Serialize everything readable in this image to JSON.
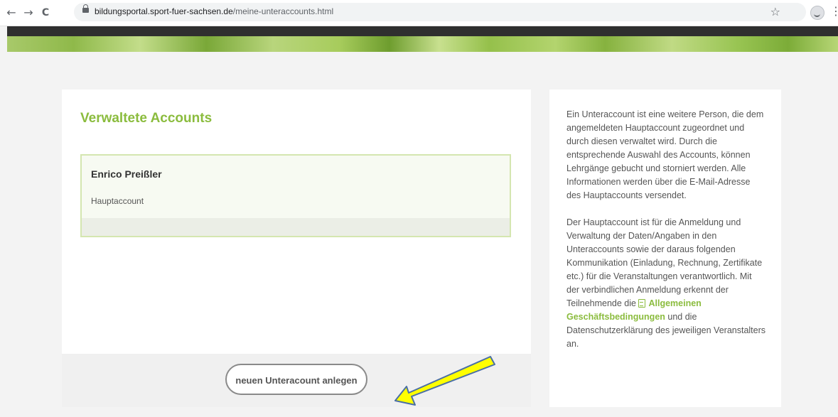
{
  "browser": {
    "back_icon": "←",
    "forward_icon": "→",
    "reload_icon": "C",
    "url_domain": "bildungsportal.sport-fuer-sachsen.de",
    "url_path": "/meine-unteraccounts.html",
    "star_icon": "☆",
    "menu_icon": "⋮"
  },
  "main": {
    "title": "Verwaltete Accounts",
    "account": {
      "name": "Enrico Preißler",
      "role": "Hauptaccount"
    },
    "new_button_label": "neuen Unteracount anlegen"
  },
  "sidebar": {
    "paragraph1": "Ein Unteraccount ist eine weitere Person, die dem angemeldeten Hauptaccount zugeordnet und durch diesen verwaltet wird. Durch die entsprechende Auswahl des Accounts, können Lehrgänge gebucht und storniert werden. Alle Informationen werden über die E-Mail-Adresse des Hauptaccounts versendet.",
    "paragraph2_before": "Der Hauptaccount ist für die Anmeldung und Verwaltung der Daten/Angaben in den Unteraccounts sowie der daraus folgenden Kommunikation (Einladung, Rechnung, Zertifikate etc.) für die Veranstaltungen verantwortlich. Mit der verbindlichen Anmeldung erkennt der Teilnehmende die",
    "agb_link": "Allgemeinen Geschäftsbedingungen",
    "paragraph2_after": "und die Datenschutzerklärung des jeweiligen Veranstalters an."
  },
  "colors": {
    "accent": "#8bbc3e",
    "arrow_fill": "#ffff00",
    "arrow_stroke": "#4a6fa5"
  }
}
